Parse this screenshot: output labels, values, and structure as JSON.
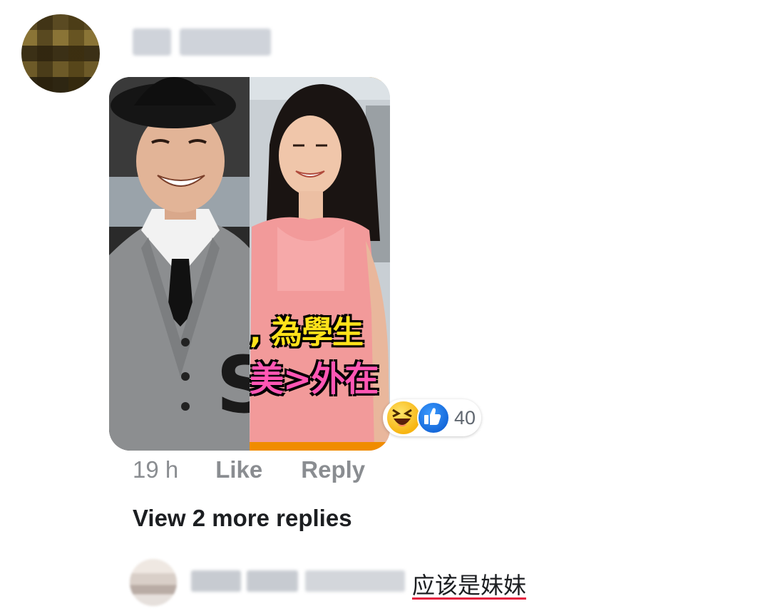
{
  "comment": {
    "image_caption_line1": ", 為學生",
    "image_caption_line2": "美>外在",
    "reactions": {
      "icons": [
        "haha-emoji",
        "like-emoji"
      ],
      "count": "40",
      "haha_color": "#f7b512",
      "like_color": "#1877f2"
    },
    "time": "19 h",
    "like_label": "Like",
    "reply_label": "Reply"
  },
  "replies": {
    "view_more_label": "View 2 more replies"
  },
  "reply": {
    "text": "应该是妹妹"
  }
}
